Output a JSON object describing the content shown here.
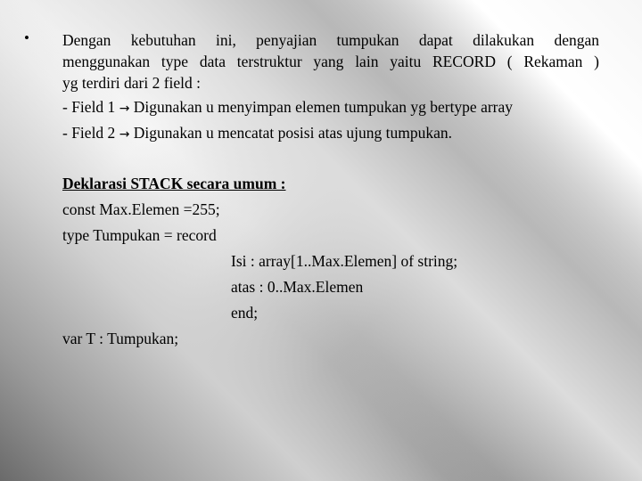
{
  "bullet_symbol": "•",
  "paragraph": {
    "line1": "Dengan kebutuhan ini, penyajian tumpukan dapat dilakukan dengan",
    "line2": "menggunakan type data terstruktur yang lain yaitu RECORD ( Rekaman )",
    "line3": "yg terdiri dari 2 field :"
  },
  "fields": [
    {
      "prefix": "- Field 1",
      "arrow": "→",
      "text": "Digunakan u menyimpan elemen tumpukan yg bertype array"
    },
    {
      "prefix": "- Field 2",
      "arrow": "→",
      "text": "Digunakan u mencatat posisi atas ujung tumpukan."
    }
  ],
  "declaration": {
    "heading": "Deklarasi STACK secara umum  :",
    "const_line": "const Max.Elemen =255;",
    "type_line": "type Tumpukan = record",
    "isi_line": "Isi : array[1..Max.Elemen] of string;",
    "atas_line": "atas : 0..Max.Elemen",
    "end_line": "end;",
    "var_line": "var T : Tumpukan;"
  }
}
